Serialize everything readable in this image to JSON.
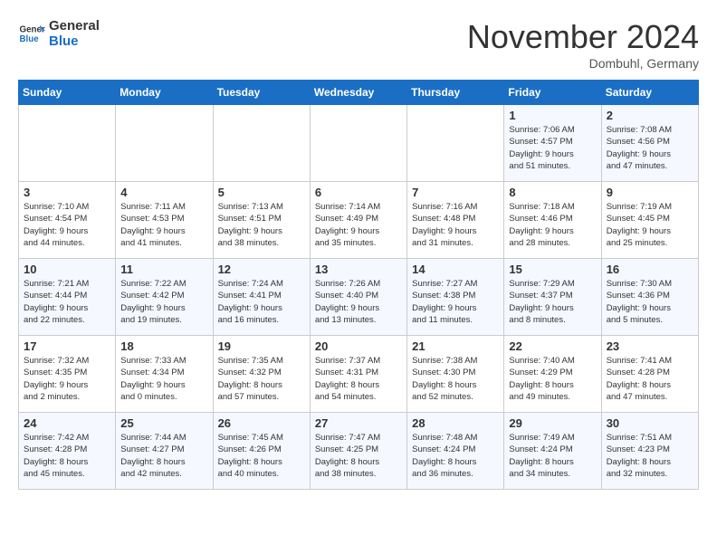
{
  "logo": {
    "text_general": "General",
    "text_blue": "Blue"
  },
  "title": "November 2024",
  "location": "Dombuhl, Germany",
  "weekdays": [
    "Sunday",
    "Monday",
    "Tuesday",
    "Wednesday",
    "Thursday",
    "Friday",
    "Saturday"
  ],
  "weeks": [
    [
      {
        "day": "",
        "info": ""
      },
      {
        "day": "",
        "info": ""
      },
      {
        "day": "",
        "info": ""
      },
      {
        "day": "",
        "info": ""
      },
      {
        "day": "",
        "info": ""
      },
      {
        "day": "1",
        "info": "Sunrise: 7:06 AM\nSunset: 4:57 PM\nDaylight: 9 hours\nand 51 minutes."
      },
      {
        "day": "2",
        "info": "Sunrise: 7:08 AM\nSunset: 4:56 PM\nDaylight: 9 hours\nand 47 minutes."
      }
    ],
    [
      {
        "day": "3",
        "info": "Sunrise: 7:10 AM\nSunset: 4:54 PM\nDaylight: 9 hours\nand 44 minutes."
      },
      {
        "day": "4",
        "info": "Sunrise: 7:11 AM\nSunset: 4:53 PM\nDaylight: 9 hours\nand 41 minutes."
      },
      {
        "day": "5",
        "info": "Sunrise: 7:13 AM\nSunset: 4:51 PM\nDaylight: 9 hours\nand 38 minutes."
      },
      {
        "day": "6",
        "info": "Sunrise: 7:14 AM\nSunset: 4:49 PM\nDaylight: 9 hours\nand 35 minutes."
      },
      {
        "day": "7",
        "info": "Sunrise: 7:16 AM\nSunset: 4:48 PM\nDaylight: 9 hours\nand 31 minutes."
      },
      {
        "day": "8",
        "info": "Sunrise: 7:18 AM\nSunset: 4:46 PM\nDaylight: 9 hours\nand 28 minutes."
      },
      {
        "day": "9",
        "info": "Sunrise: 7:19 AM\nSunset: 4:45 PM\nDaylight: 9 hours\nand 25 minutes."
      }
    ],
    [
      {
        "day": "10",
        "info": "Sunrise: 7:21 AM\nSunset: 4:44 PM\nDaylight: 9 hours\nand 22 minutes."
      },
      {
        "day": "11",
        "info": "Sunrise: 7:22 AM\nSunset: 4:42 PM\nDaylight: 9 hours\nand 19 minutes."
      },
      {
        "day": "12",
        "info": "Sunrise: 7:24 AM\nSunset: 4:41 PM\nDaylight: 9 hours\nand 16 minutes."
      },
      {
        "day": "13",
        "info": "Sunrise: 7:26 AM\nSunset: 4:40 PM\nDaylight: 9 hours\nand 13 minutes."
      },
      {
        "day": "14",
        "info": "Sunrise: 7:27 AM\nSunset: 4:38 PM\nDaylight: 9 hours\nand 11 minutes."
      },
      {
        "day": "15",
        "info": "Sunrise: 7:29 AM\nSunset: 4:37 PM\nDaylight: 9 hours\nand 8 minutes."
      },
      {
        "day": "16",
        "info": "Sunrise: 7:30 AM\nSunset: 4:36 PM\nDaylight: 9 hours\nand 5 minutes."
      }
    ],
    [
      {
        "day": "17",
        "info": "Sunrise: 7:32 AM\nSunset: 4:35 PM\nDaylight: 9 hours\nand 2 minutes."
      },
      {
        "day": "18",
        "info": "Sunrise: 7:33 AM\nSunset: 4:34 PM\nDaylight: 9 hours\nand 0 minutes."
      },
      {
        "day": "19",
        "info": "Sunrise: 7:35 AM\nSunset: 4:32 PM\nDaylight: 8 hours\nand 57 minutes."
      },
      {
        "day": "20",
        "info": "Sunrise: 7:37 AM\nSunset: 4:31 PM\nDaylight: 8 hours\nand 54 minutes."
      },
      {
        "day": "21",
        "info": "Sunrise: 7:38 AM\nSunset: 4:30 PM\nDaylight: 8 hours\nand 52 minutes."
      },
      {
        "day": "22",
        "info": "Sunrise: 7:40 AM\nSunset: 4:29 PM\nDaylight: 8 hours\nand 49 minutes."
      },
      {
        "day": "23",
        "info": "Sunrise: 7:41 AM\nSunset: 4:28 PM\nDaylight: 8 hours\nand 47 minutes."
      }
    ],
    [
      {
        "day": "24",
        "info": "Sunrise: 7:42 AM\nSunset: 4:28 PM\nDaylight: 8 hours\nand 45 minutes."
      },
      {
        "day": "25",
        "info": "Sunrise: 7:44 AM\nSunset: 4:27 PM\nDaylight: 8 hours\nand 42 minutes."
      },
      {
        "day": "26",
        "info": "Sunrise: 7:45 AM\nSunset: 4:26 PM\nDaylight: 8 hours\nand 40 minutes."
      },
      {
        "day": "27",
        "info": "Sunrise: 7:47 AM\nSunset: 4:25 PM\nDaylight: 8 hours\nand 38 minutes."
      },
      {
        "day": "28",
        "info": "Sunrise: 7:48 AM\nSunset: 4:24 PM\nDaylight: 8 hours\nand 36 minutes."
      },
      {
        "day": "29",
        "info": "Sunrise: 7:49 AM\nSunset: 4:24 PM\nDaylight: 8 hours\nand 34 minutes."
      },
      {
        "day": "30",
        "info": "Sunrise: 7:51 AM\nSunset: 4:23 PM\nDaylight: 8 hours\nand 32 minutes."
      }
    ]
  ]
}
